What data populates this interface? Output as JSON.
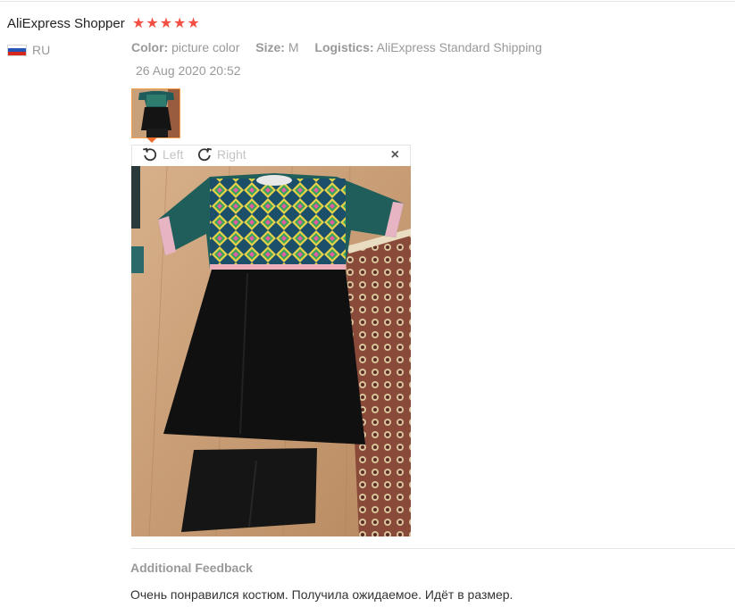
{
  "review": {
    "user_name": "AliExpress Shopper",
    "country_code": "RU",
    "rating": 5,
    "stars": [
      "★",
      "★",
      "★",
      "★",
      "★"
    ],
    "color_label": "Color:",
    "color_value": "picture color",
    "size_label": "Size:",
    "size_value": "M",
    "logistics_label": "Logistics:",
    "logistics_value": "AliExpress Standard Shipping",
    "date": "26 Aug 2020 20:52"
  },
  "viewer": {
    "rotate_left_label": "Left",
    "rotate_right_label": "Right",
    "close_glyph": "×"
  },
  "feedback": {
    "title": "Additional Feedback",
    "text": "Очень понравился костюм. Получила ожидаемое. Идёт в размер."
  },
  "colors": {
    "star": "#f44e42",
    "thumb_border": "#f6a24d",
    "muted_text": "#999999"
  }
}
